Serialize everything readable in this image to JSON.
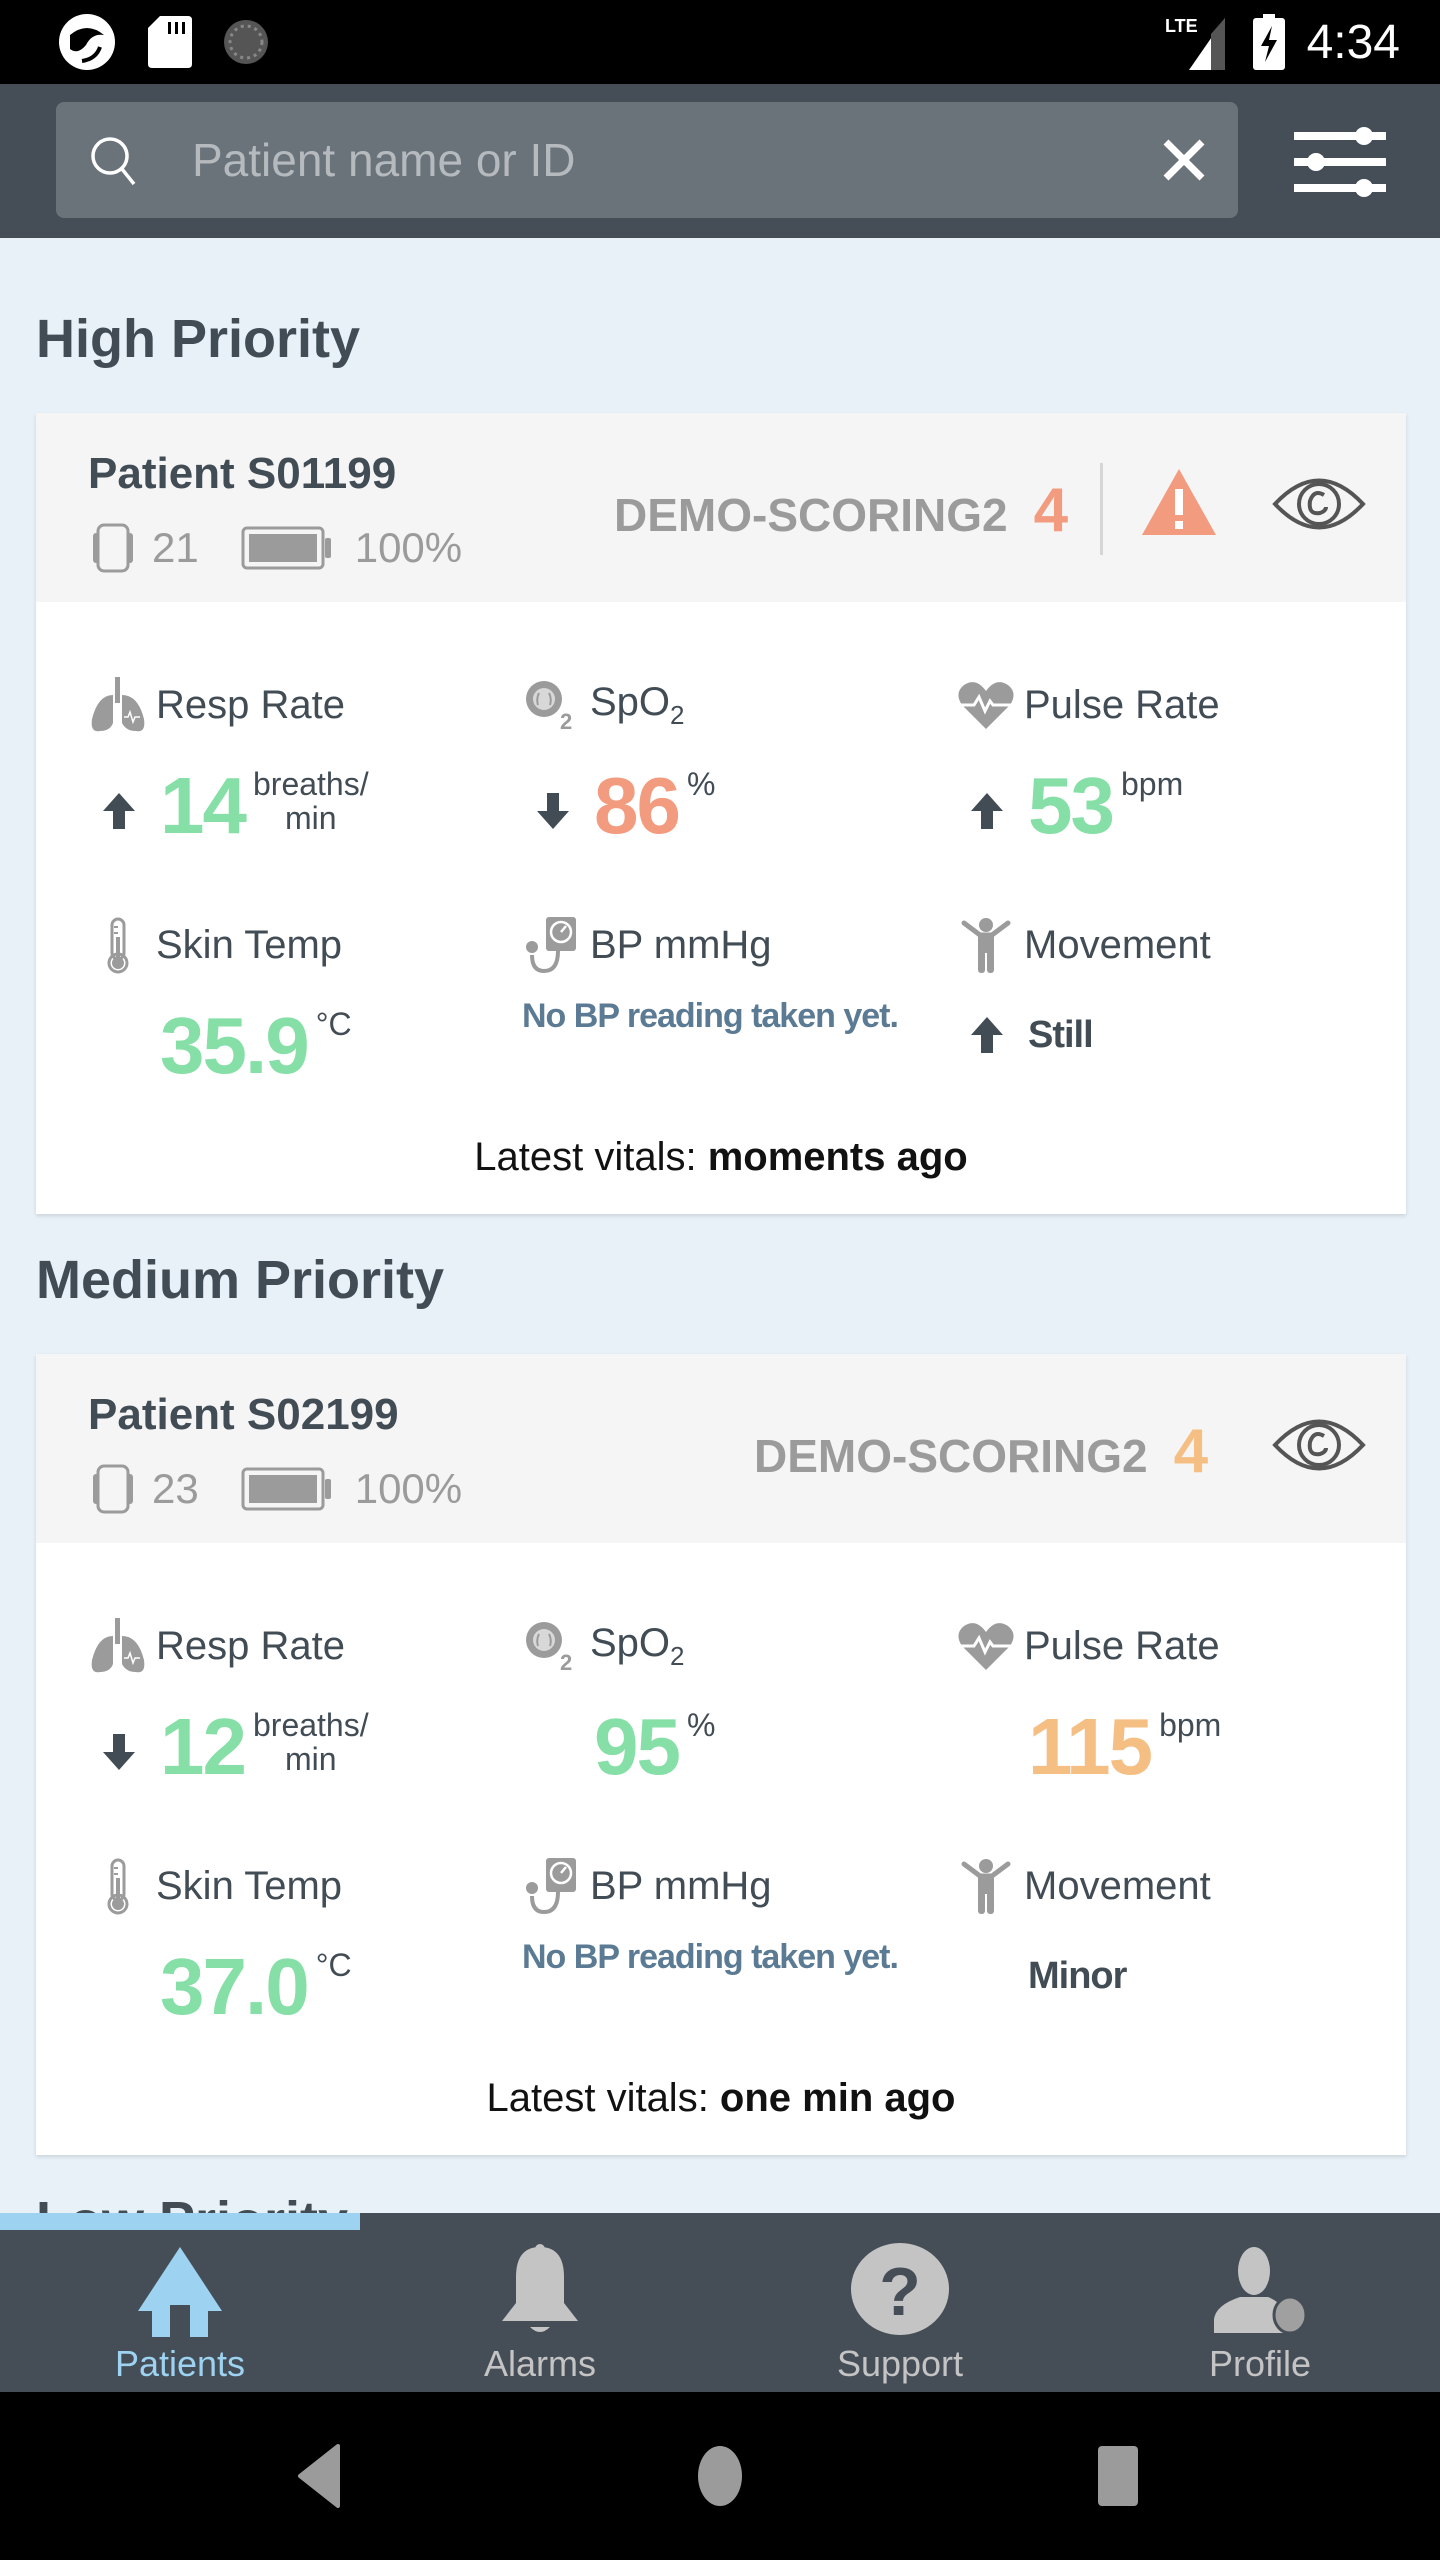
{
  "status_bar": {
    "time": "4:34",
    "network": "LTE",
    "icons_left": [
      "app-logo-icon",
      "sd-card-icon",
      "sync-dial-icon"
    ],
    "icons_right": [
      "lte-signal-icon",
      "battery-charging-icon"
    ]
  },
  "search": {
    "placeholder": "Patient name or ID",
    "value": ""
  },
  "sections": [
    {
      "title": "High Priority",
      "patient": {
        "name": "Patient S01199",
        "device_id": "21",
        "battery": "100%",
        "score_label": "DEMO-SCORING2",
        "score": "4",
        "score_color": "#f29b7e",
        "has_alert": true,
        "vitals": {
          "resp_rate": {
            "label": "Resp Rate",
            "value": "14",
            "unit_line1": "breaths/",
            "unit_line2": "min",
            "trend": "up",
            "color": "#86dfa6"
          },
          "spo2": {
            "label": "SpO",
            "label_sub": "2",
            "value": "86",
            "unit": "%",
            "trend": "down",
            "color": "#f29b7e"
          },
          "pulse": {
            "label": "Pulse Rate",
            "value": "53",
            "unit": "bpm",
            "trend": "up",
            "color": "#86dfa6"
          },
          "skin_temp": {
            "label": "Skin Temp",
            "value": "35.9",
            "unit": "°C",
            "color": "#86dfa6"
          },
          "bp": {
            "label": "BP mmHg",
            "value": "No BP reading taken yet."
          },
          "movement": {
            "label": "Movement",
            "value": "Still",
            "trend": "up"
          }
        },
        "latest_label": "Latest vitals: ",
        "latest_value": "moments ago"
      }
    },
    {
      "title": "Medium Priority",
      "patient": {
        "name": "Patient S02199",
        "device_id": "23",
        "battery": "100%",
        "score_label": "DEMO-SCORING2",
        "score": "4",
        "score_color": "#f5bf84",
        "has_alert": false,
        "vitals": {
          "resp_rate": {
            "label": "Resp Rate",
            "value": "12",
            "unit_line1": "breaths/",
            "unit_line2": "min",
            "trend": "down",
            "color": "#86dfa6"
          },
          "spo2": {
            "label": "SpO",
            "label_sub": "2",
            "value": "95",
            "unit": "%",
            "trend": "none",
            "color": "#86dfa6"
          },
          "pulse": {
            "label": "Pulse Rate",
            "value": "115",
            "unit": "bpm",
            "trend": "none",
            "color": "#f5bf84"
          },
          "skin_temp": {
            "label": "Skin Temp",
            "value": "37.0",
            "unit": "°C",
            "color": "#86dfa6"
          },
          "bp": {
            "label": "BP mmHg",
            "value": "No BP reading taken yet."
          },
          "movement": {
            "label": "Movement",
            "value": "Minor",
            "trend": "none"
          }
        },
        "latest_label": "Latest vitals: ",
        "latest_value": "one min ago"
      }
    },
    {
      "title": "Low Priority"
    }
  ],
  "bottom_nav": {
    "active": "Patients",
    "items": [
      {
        "label": "Patients",
        "icon": "home-icon"
      },
      {
        "label": "Alarms",
        "icon": "bell-icon"
      },
      {
        "label": "Support",
        "icon": "help-icon"
      },
      {
        "label": "Profile",
        "icon": "profile-icon"
      }
    ]
  },
  "colors": {
    "appbar": "#454e57",
    "search_bg": "#6a727a",
    "background": "#e8f0f8",
    "active_nav": "#9dd3f1",
    "normal_value": "#86dfa6",
    "high_alert": "#f29b7e",
    "medium_alert": "#f5bf84",
    "bp_text": "#5b7a93"
  }
}
